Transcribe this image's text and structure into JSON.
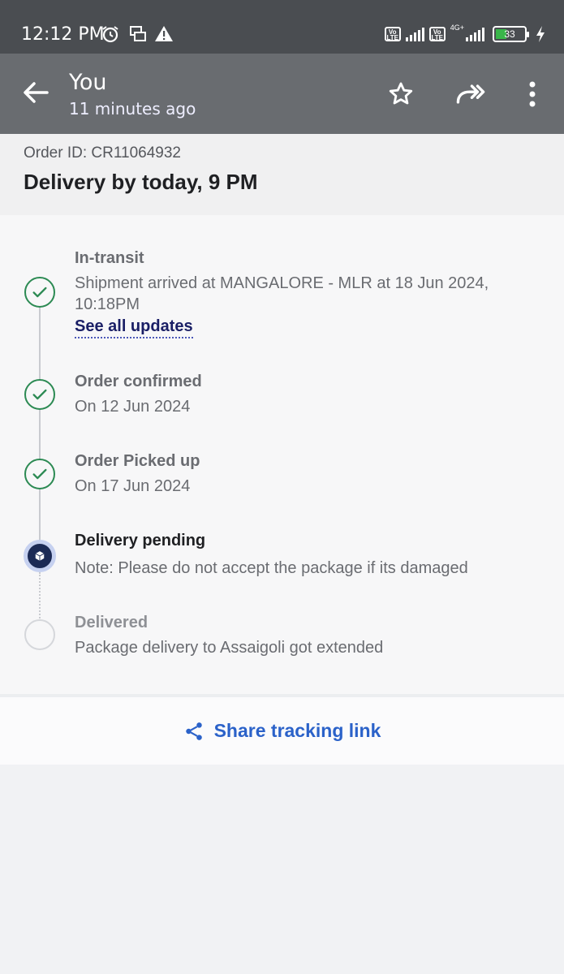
{
  "status_bar": {
    "time": "12:12 PM",
    "icons": [
      "alarm-icon",
      "message-icon",
      "warning-icon"
    ],
    "network": "4G+",
    "volte_label": "Vo LTE",
    "battery": "33"
  },
  "header": {
    "title": "You",
    "subtitle": "11 minutes ago",
    "actions": [
      "star-icon",
      "forward-icon",
      "more-vert-icon"
    ]
  },
  "order": {
    "id_label": "Order ID: CR11064932",
    "delivery_by": "Delivery by today, 9 PM"
  },
  "timeline": [
    {
      "title": "In-transit",
      "desc": "Shipment arrived at MANGALORE - MLR at 18 Jun 2024, 10:18PM",
      "status": "done"
    },
    {
      "title": "Order confirmed",
      "desc": "On 12 Jun 2024",
      "status": "done"
    },
    {
      "title": "Order Picked up",
      "desc": "On 17 Jun 2024",
      "status": "done"
    },
    {
      "title": "Delivery pending",
      "desc": "Note: Please do not accept the package if its damaged",
      "status": "current"
    },
    {
      "title": "Delivered",
      "desc": "Package delivery to Assaigoli got extended",
      "status": "pending"
    }
  ],
  "see_all_updates": "See all updates",
  "share": {
    "label": "Share tracking link"
  },
  "colors": {
    "status_bar_bg": "#4a4d51",
    "app_bar_bg": "#696c70",
    "success_green": "#2c8a53",
    "pending_navy": "#1b2a55",
    "link_blue": "#2b62c9"
  }
}
